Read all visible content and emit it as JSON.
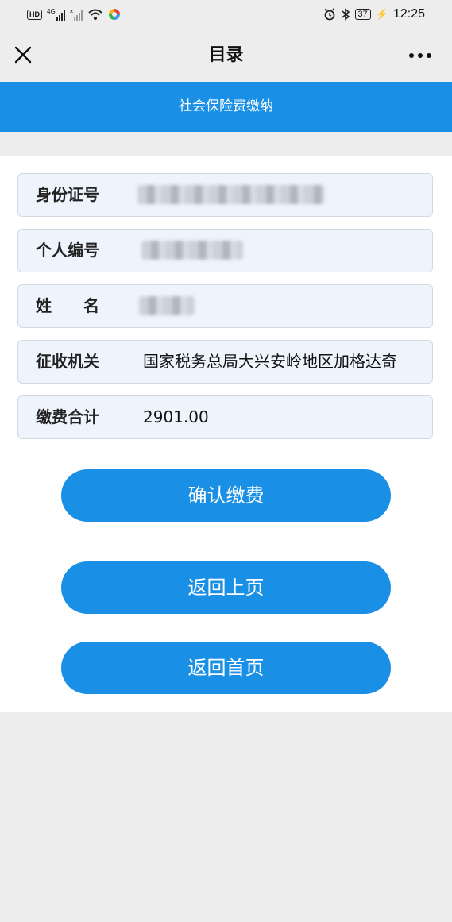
{
  "status_bar": {
    "hd_label": "HD",
    "signal_4g_label": "4G",
    "battery_level": "37",
    "time": "12:25"
  },
  "nav": {
    "title": "目录"
  },
  "header": {
    "title": "社会保险费缴纳"
  },
  "form": {
    "rows": [
      {
        "label": "身份证号",
        "value": ""
      },
      {
        "label": "个人编号",
        "value": ""
      },
      {
        "label": "姓　　名",
        "value": ""
      },
      {
        "label": "征收机关",
        "value": "国家税务总局大兴安岭地区加格达奇"
      },
      {
        "label": "缴费合计",
        "value": "2901.00"
      }
    ]
  },
  "buttons": {
    "confirm_label": "确认缴费",
    "back_label": "返回上页",
    "home_label": "返回首页"
  },
  "colors": {
    "accent": "#1a8fe6",
    "row_bg": "#eef4fb",
    "page_bg": "#ededed"
  }
}
